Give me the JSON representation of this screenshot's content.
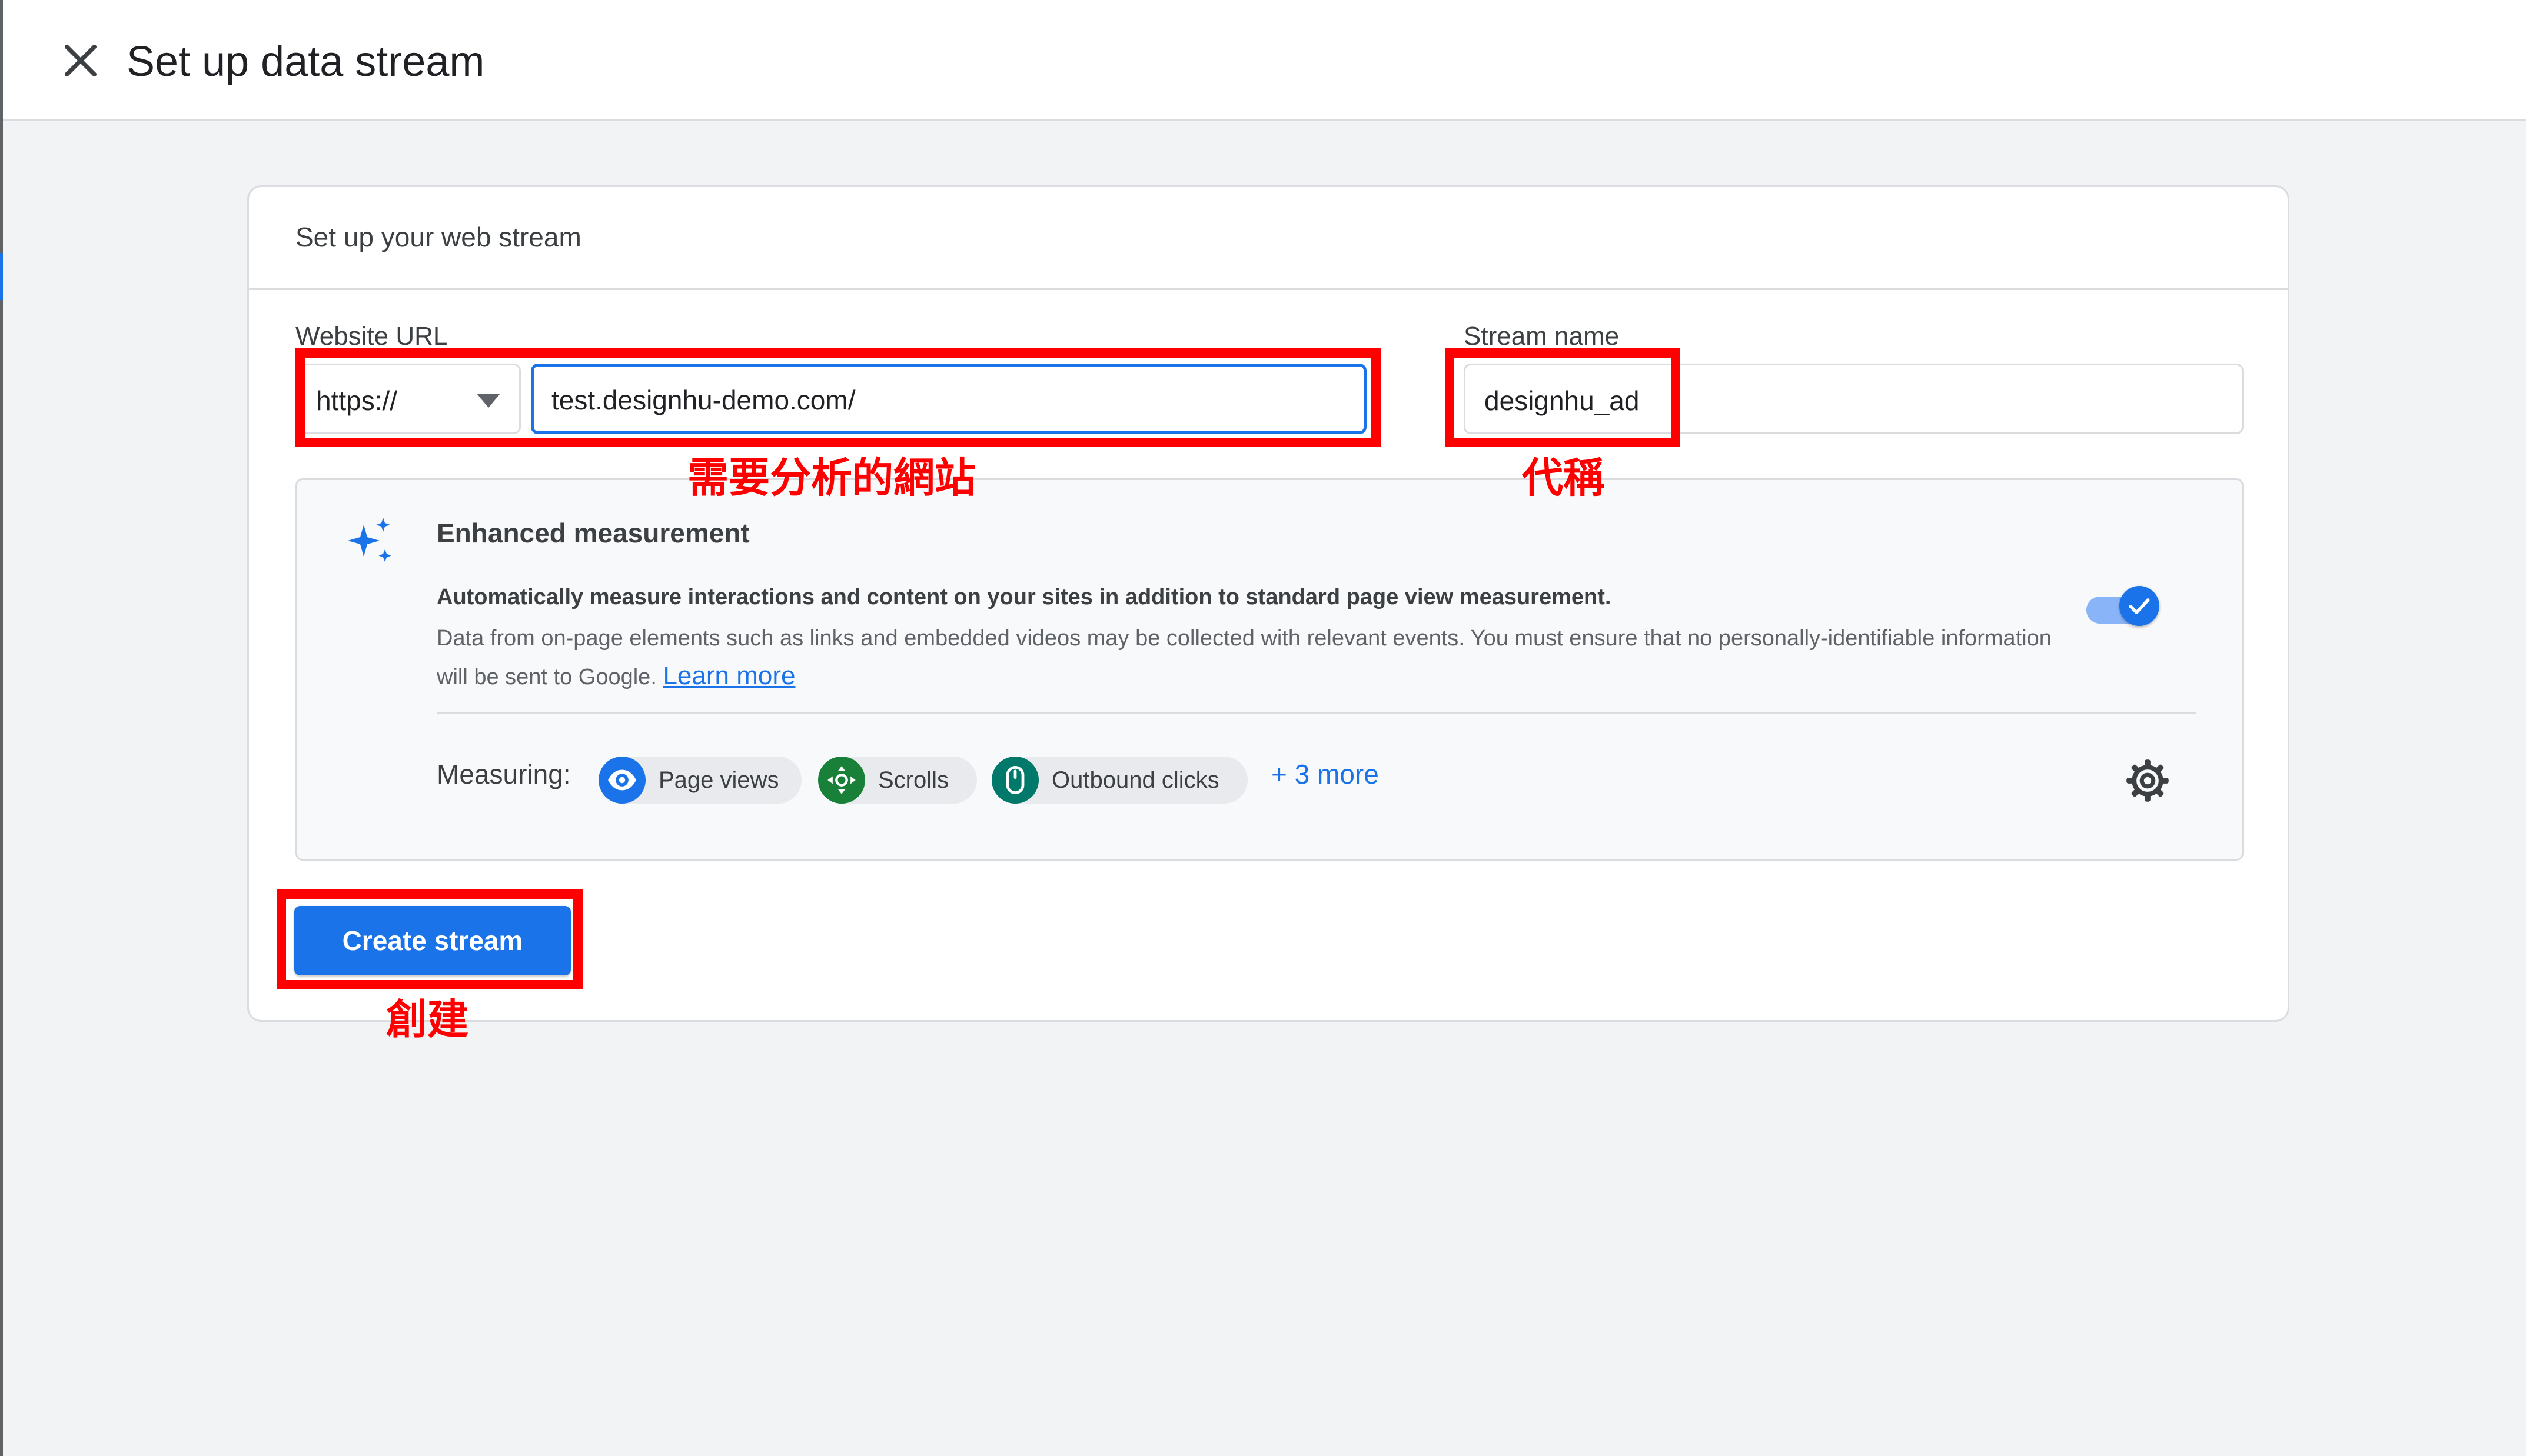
{
  "header": {
    "title": "Set up data stream"
  },
  "card": {
    "title": "Set up your web stream",
    "website_url_label": "Website URL",
    "protocol_value": "https://",
    "url_value": "test.designhu-demo.com/",
    "stream_name_label": "Stream name",
    "stream_name_value": "designhu_ad"
  },
  "enhanced": {
    "title": "Enhanced measurement",
    "lead": "Automatically measure interactions and content on your sites in addition to standard page view measurement.",
    "desc": "Data from on-page elements such as links and embedded videos may be collected with relevant events. You must ensure that no personally-identifiable information will be sent to Google.",
    "learn_more": "Learn more",
    "toggle_on": true,
    "measuring_label": "Measuring:",
    "chips": [
      {
        "label": "Page views",
        "icon": "eye-icon",
        "color": "#1a73e8"
      },
      {
        "label": "Scrolls",
        "icon": "scroll-arrows-icon",
        "color": "#188038"
      },
      {
        "label": "Outbound clicks",
        "icon": "mouse-icon",
        "color": "#00796b"
      }
    ],
    "more_link": "+ 3 more"
  },
  "actions": {
    "create_label": "Create stream"
  },
  "annotations": {
    "url_note": "需要分析的網站",
    "name_note": "代稱",
    "create_note": "創建",
    "color": "#ff0000"
  },
  "colors": {
    "accent": "#1a73e8",
    "background": "#f1f3f4"
  }
}
